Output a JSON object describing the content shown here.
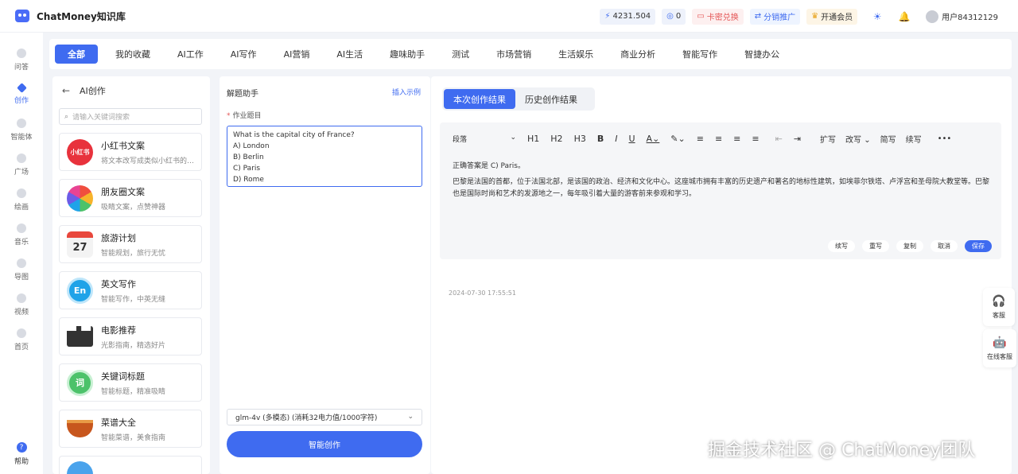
{
  "app": {
    "name": "ChatMoney知识库"
  },
  "header": {
    "power": "4231.504",
    "count": "0",
    "card_redeem": "卡密兑换",
    "affiliate": "分销推广",
    "vip": "开通会员",
    "user": "用户84312129"
  },
  "leftnav": {
    "items": [
      {
        "label": "问答"
      },
      {
        "label": "创作"
      },
      {
        "label": "智能体"
      },
      {
        "label": "广场"
      },
      {
        "label": "绘画"
      },
      {
        "label": "音乐"
      },
      {
        "label": "导图"
      },
      {
        "label": "视频"
      },
      {
        "label": "首页"
      }
    ],
    "help": "帮助"
  },
  "categories": [
    "全部",
    "我的收藏",
    "AI工作",
    "AI写作",
    "AI营销",
    "AI生活",
    "趣味助手",
    "测试",
    "市场营销",
    "生活娱乐",
    "商业分析",
    "智能写作",
    "智捷办公"
  ],
  "tools_panel": {
    "title": "AI创作",
    "search_placeholder": "请输入关键词搜索",
    "items": [
      {
        "name": "小红书文案",
        "desc": "将文本改写成类似小红书的风格",
        "icon_text": "小红书",
        "color": "#e8323c"
      },
      {
        "name": "朋友圈文案",
        "desc": "吸睛文案，点赞神器",
        "icon_text": "",
        "color": "#f0a020"
      },
      {
        "name": "旅游计划",
        "desc": "智能规划，旅行无忧",
        "icon_text": "27",
        "color": "#f5f5f5"
      },
      {
        "name": "英文写作",
        "desc": "智能写作，中英无缝",
        "icon_text": "En",
        "color": "#1fa3e8"
      },
      {
        "name": "电影推荐",
        "desc": "光影指南，精选好片",
        "icon_text": "",
        "color": "#333333"
      },
      {
        "name": "关键词标题",
        "desc": "智能标题，精准吸睛",
        "icon_text": "词",
        "color": "#4cc26a"
      },
      {
        "name": "菜谱大全",
        "desc": "智能菜谱，美食指南",
        "icon_text": "",
        "color": "#c7561d"
      }
    ]
  },
  "form": {
    "title": "解题助手",
    "insert_example": "插入示例",
    "field_label": "作业题目",
    "question": "What is the capital city of France?\nA) London\nB) Berlin\nC) Paris\nD) Rome",
    "model": "glm-4v (多模态) (消耗32电力值/1000字符)",
    "submit": "智能创作"
  },
  "result": {
    "tab_current": "本次创作结果",
    "tab_history": "历史创作结果",
    "toolbar": {
      "paragraph": "段落",
      "h1": "H1",
      "h2": "H2",
      "h3": "H3",
      "bold": "B",
      "italic": "I",
      "underline": "U",
      "expand": "扩写",
      "rewrite": "改写",
      "simplify": "简写",
      "continue": "续写",
      "more": "•••"
    },
    "answer": "正确答案是 C) Paris。",
    "explanation": "巴黎是法国的首都，位于法国北部，是该国的政治、经济和文化中心。这座城市拥有丰富的历史遗产和著名的地标性建筑，如埃菲尔铁塔、卢浮宫和圣母院大教堂等。巴黎也是国际时尚和艺术的发源地之一，每年吸引着大量的游客前来参观和学习。",
    "timestamp": "2024-07-30 17:55:51",
    "actions": {
      "continue": "续写",
      "rewrite": "重写",
      "copy": "复制",
      "cancel": "取消",
      "save": "保存"
    }
  },
  "float": {
    "service": "客服",
    "online_service": "在线客服"
  },
  "watermark": "掘金技术社区 @ ChatMoney团队"
}
